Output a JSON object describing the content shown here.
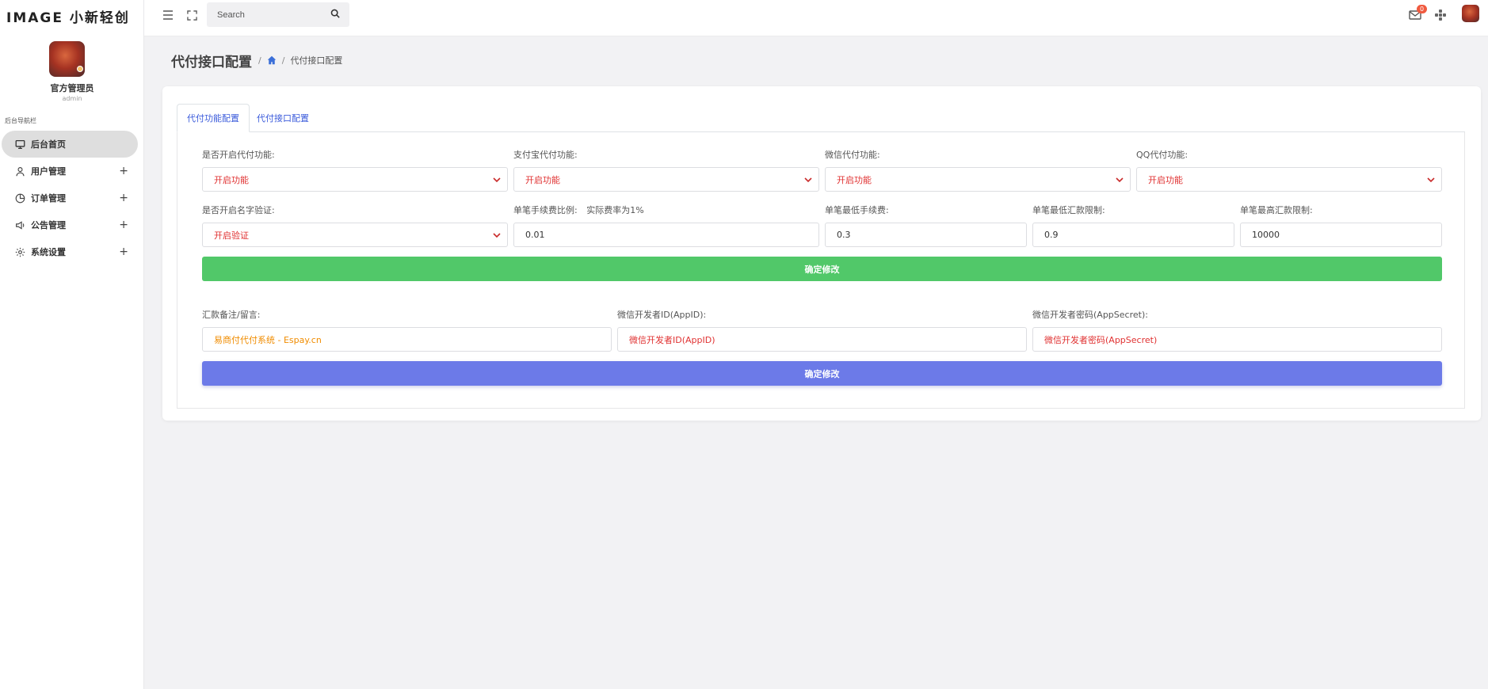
{
  "sidebar": {
    "logo": "IMAGE 小新轻创",
    "user_name": "官方管理员",
    "user_role": "admin",
    "nav_caption": "后台导航栏",
    "items": [
      {
        "label": "后台首页",
        "icon": "monitor-icon",
        "active": true
      },
      {
        "label": "用户管理",
        "icon": "user-icon",
        "expand": "+"
      },
      {
        "label": "订单管理",
        "icon": "pie-chart-icon",
        "expand": "+"
      },
      {
        "label": "公告管理",
        "icon": "megaphone-icon",
        "expand": "+"
      },
      {
        "label": "系统设置",
        "icon": "gear-icon",
        "expand": "+"
      }
    ]
  },
  "header": {
    "search_placeholder": "Search",
    "mail_badge": "0"
  },
  "page": {
    "title": "代付接口配置",
    "breadcrumb_sep": "/",
    "breadcrumb_current": "代付接口配置"
  },
  "tabs": [
    {
      "label": "代付功能配置",
      "active": true
    },
    {
      "label": "代付接口配置",
      "active": false
    }
  ],
  "form": {
    "row1": [
      {
        "label": "是否开启代付功能:",
        "value": "开启功能"
      },
      {
        "label": "支付宝代付功能:",
        "value": "开启功能"
      },
      {
        "label": "微信代付功能:",
        "value": "开启功能"
      },
      {
        "label": "QQ代付功能:",
        "value": "开启功能"
      }
    ],
    "row2": [
      {
        "label": "是否开启名字验证:",
        "value": "开启验证"
      },
      {
        "label": "单笔手续费比例:",
        "note": "实际费率为1%",
        "value": "0.01"
      },
      {
        "label": "单笔最低手续费:",
        "value": "0.3"
      },
      {
        "label": "单笔最低汇款限制:",
        "value": "0.9"
      },
      {
        "label": "单笔最高汇款限制:",
        "value": "10000"
      }
    ],
    "submit1": "确定修改",
    "row3": [
      {
        "label": "汇款备注/留言:",
        "placeholder": "易商付代付系统 - Espay.cn"
      },
      {
        "label": "微信开发者ID(AppID):",
        "placeholder": "微信开发者ID(AppID)"
      },
      {
        "label": "微信开发者密码(AppSecret):",
        "placeholder": "微信开发者密码(AppSecret)"
      }
    ],
    "submit2": "确定修改"
  },
  "colors": {
    "accent_green": "#51c869",
    "accent_blue": "#6c7ae8",
    "select_text": "#e03131",
    "link": "#3b5bdb"
  }
}
